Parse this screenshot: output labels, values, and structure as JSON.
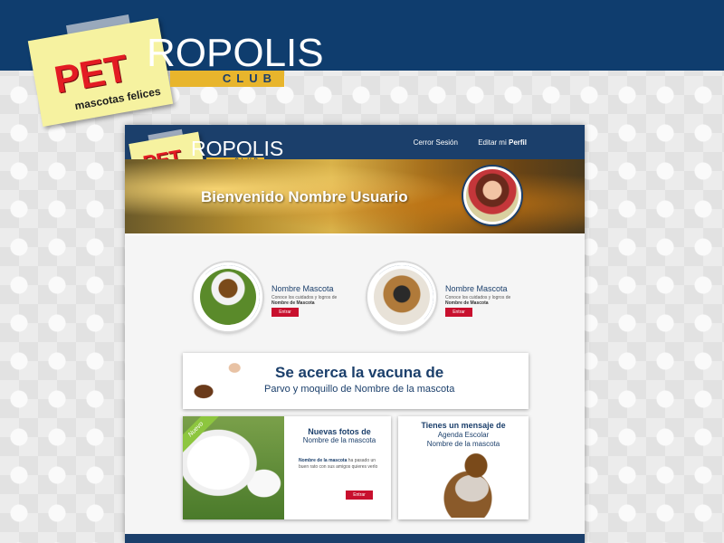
{
  "brand": {
    "pet": "PET",
    "tagline": "mascotas felices",
    "ropolis": "ROPOLIS",
    "club": "CLUB"
  },
  "header": {
    "logout": "Cerror Sesión",
    "edit_prefix": "Editar mi",
    "edit_bold": "Perfil"
  },
  "banner": {
    "welcome": "Bienvenido Nombre Usuario"
  },
  "pets": [
    {
      "name": "Nombre Mascota",
      "desc": "Conoce los cuidados y logros de",
      "desc_bold": "Nombre de Mascota",
      "button": "Entrar"
    },
    {
      "name": "Nombre Mascota",
      "desc": "Conoce los cuidados y logros de",
      "desc_bold": "Nombre de Mascota",
      "button": "Entrar"
    }
  ],
  "vaccine": {
    "title": "Se acerca la vacuna de",
    "subtitle": "Parvo y moquillo de Nombre de la mascota"
  },
  "photos": {
    "ribbon": "Nuevo",
    "title": "Nuevas fotos de",
    "subtitle": "Nombre de la mascota",
    "desc_bold": "Nombre de la mascota",
    "desc": "ha pasado un buen rato con sus amigos quieres verlo",
    "button": "Entrar"
  },
  "message": {
    "title": "Tienes un mensaje de",
    "line1": "Agenda Escolar",
    "line2": "Nombre de la mascota"
  },
  "colors": {
    "navy": "#1b3f6b",
    "top_band": "#0f3d6e",
    "accent_red": "#c8102e",
    "logo_red": "#e31b23",
    "note_yellow": "#f6f2a0",
    "club_gold": "#e8b52c",
    "ribbon_green": "#8dc63f"
  }
}
